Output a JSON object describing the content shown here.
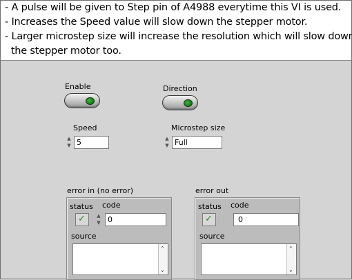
{
  "description": {
    "lines": [
      "- A pulse will be given to Step pin of A4988 everytime this VI is used.",
      "- Increases the Speed value will slow down the stepper motor.",
      "- Larger microstep size will increase the resolution which will slow down",
      "  the stepper motor too."
    ]
  },
  "controls": {
    "enable_label": "Enable",
    "direction_label": "Direction",
    "speed_label": "Speed",
    "speed_value": "5",
    "microstep_label": "Microstep size",
    "microstep_value": "Full"
  },
  "error_in": {
    "title": "error in (no error)",
    "status_label": "status",
    "code_label": "code",
    "code_value": "0",
    "source_label": "source",
    "source_value": ""
  },
  "error_out": {
    "title": "error out",
    "status_label": "status",
    "code_label": "code",
    "code_value": "0",
    "source_label": "source",
    "source_value": ""
  },
  "icons": {
    "status_check": "✓",
    "spinner_up": "▲",
    "spinner_down": "▼",
    "scroll_up": "⌃",
    "scroll_down": "⌄"
  },
  "colors": {
    "led_green": "#1f8a1f",
    "panel_gray": "#d4d4d4",
    "cluster_gray": "#bcbcbc"
  }
}
